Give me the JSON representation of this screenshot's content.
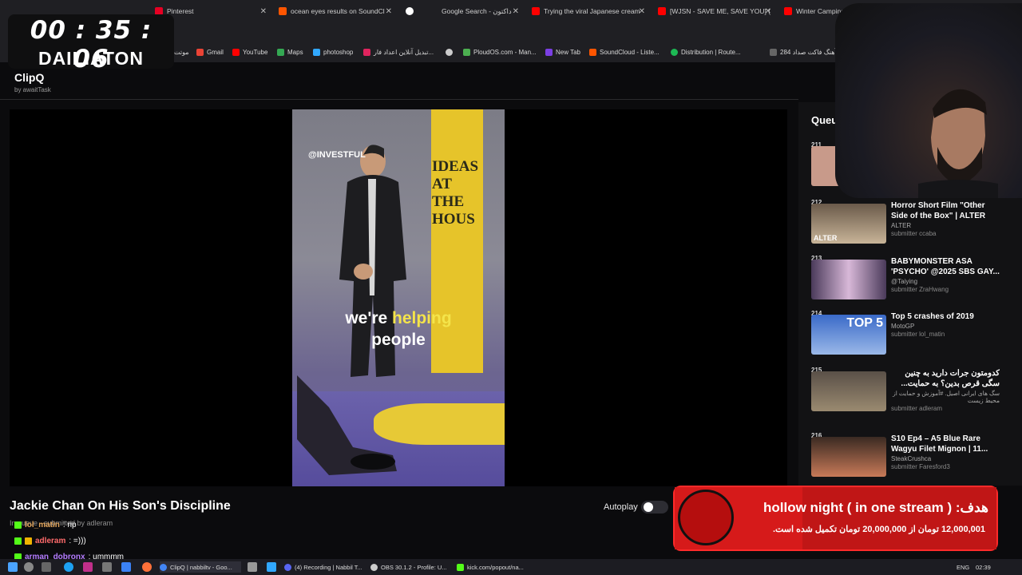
{
  "timer": {
    "digits": "00 : 35 : 06",
    "label": "DAILIATON"
  },
  "browser": {
    "tabs": [
      {
        "label": "Pinterest",
        "color": "#e60023"
      },
      {
        "label": "ocean eyes results on SoundCl",
        "color": "#ff5500"
      },
      {
        "label": "Google Search - داكتون",
        "color": "#4285f4"
      },
      {
        "label": "Trying the viral Japanese cream",
        "color": "#ff0000"
      },
      {
        "label": "[WJSN - SAVE ME, SAVE YOU] (",
        "color": "#ff0000"
      },
      {
        "label": "Winter Camping in Alask",
        "color": "#ff0000"
      }
    ],
    "bookmarks": [
      {
        "label": "موتت",
        "color": "#888888"
      },
      {
        "label": "Gmail",
        "color": "#ea4335"
      },
      {
        "label": "YouTube",
        "color": "#ff0000"
      },
      {
        "label": "Maps",
        "color": "#34a853"
      },
      {
        "label": "photoshop",
        "color": "#31a8ff"
      },
      {
        "label": "تبدیل آنلاین اعداد فار...",
        "color": "#e0245e"
      },
      {
        "label": "",
        "color": "#cccccc"
      },
      {
        "label": "PloudOS.com - Man...",
        "color": "#4caf50"
      },
      {
        "label": "New Tab",
        "color": "#7b3fe4"
      },
      {
        "label": "SoundCloud - Liste...",
        "color": "#ff5500"
      },
      {
        "label": "Distribution | Route...",
        "color": "#1db954"
      },
      {
        "label": "284 آهنگ فاکت صداد...",
        "color": "#666666"
      }
    ]
  },
  "app": {
    "title": "ClipQ",
    "by": "by awaitTask"
  },
  "video": {
    "watermark": "@INVESTFUL",
    "banner": "IDEAS AT THE HOUS",
    "caption_part1": "we're ",
    "caption_highlight": "helping",
    "caption_line2": "people",
    "title": "Jackie Chan On His Son's Discipline",
    "submitted_by": "In queue · submitted by adleram"
  },
  "autoplay": {
    "label": "Autoplay",
    "enabled": false
  },
  "chat": [
    {
      "user": "lol_matin",
      "message": ": rip",
      "color": "#e0a35a"
    },
    {
      "user": "adleram",
      "message": ": =)))",
      "color": "#ff6b6b"
    },
    {
      "user": "arman_dobronx",
      "message": ": ummmm",
      "color": "#b47cff"
    }
  ],
  "queue": {
    "title": "Queue",
    "items": [
      {
        "num": "211",
        "title": "",
        "channel": "",
        "submitter": "",
        "thumb": "#c89a8a"
      },
      {
        "num": "212",
        "title": "Horror Short Film \"Other Side of the Box\" | ALTER",
        "channel": "ALTER",
        "submitter": "submitter ccaba",
        "thumb": "#8a7a6a",
        "thumb_text": "ALTER"
      },
      {
        "num": "213",
        "title": "BABYMONSTER ASA 'PSYCHO' @2025 SBS GAY...",
        "channel": "@Taiying",
        "submitter": "submitter ZraHwang",
        "thumb": "#c9a7c9"
      },
      {
        "num": "214",
        "title": "Top 5 crashes of 2019",
        "channel": "MotoGP",
        "submitter": "submitter lol_matin",
        "thumb": "#5a7ab8",
        "thumb_text": "TOP 5"
      },
      {
        "num": "215",
        "title": "کدومتون جرات دارید به چنین سگی قرص بدین؟ به حمایت...",
        "channel": "سگ های ایرانی اصیل. #آموزش و حمایت از محیط زیست",
        "submitter": "submitter adleram",
        "thumb": "#7a6a58",
        "rtl": true
      },
      {
        "num": "216",
        "title": "S10 Ep4 – A5 Blue Rare Wagyu Filet Mignon | 11...",
        "channel": "SteakCrushca",
        "submitter": "submitter Faresford3",
        "thumb": "#a86850"
      }
    ]
  },
  "goal": {
    "title": "هدف: ( hollow night ( in one stream",
    "amount": "12,000,001 تومان از 20,000,000 تومان تکمیل شده است."
  },
  "taskbar": {
    "items": [
      {
        "label": "ClipQ | nabbiltv - Goo...",
        "color": "#4285f4"
      },
      {
        "label": "(4) Recording | Nabbil T...",
        "color": "#5865f2"
      },
      {
        "label": "OBS 30.1.2 - Profile: U...",
        "color": "#cccccc"
      },
      {
        "label": "kick.com/popout/na...",
        "color": "#53fc18"
      }
    ],
    "lang": "ENG",
    "time": "02:39"
  }
}
